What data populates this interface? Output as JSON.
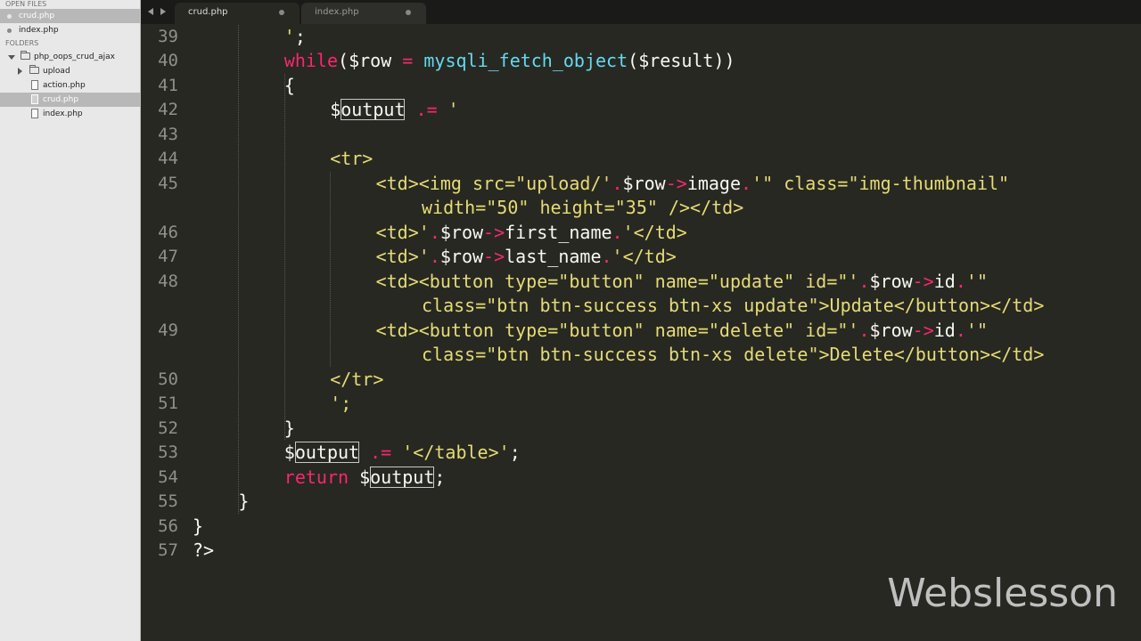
{
  "sidebar": {
    "open_files_header": "OPEN FILES",
    "open_files": [
      {
        "label": "crud.php",
        "active": true
      },
      {
        "label": "index.php",
        "active": false
      }
    ],
    "folders_header": "FOLDERS",
    "project_folder": "php_oops_crud_ajax",
    "folder_items": [
      {
        "label": "upload",
        "type": "folder",
        "active": false
      },
      {
        "label": "action.php",
        "type": "file",
        "active": false
      },
      {
        "label": "crud.php",
        "type": "file",
        "active": true
      },
      {
        "label": "index.php",
        "type": "file",
        "active": false
      }
    ]
  },
  "tabs": [
    {
      "label": "crud.php",
      "active": true
    },
    {
      "label": "index.php",
      "active": false
    }
  ],
  "editor": {
    "line_numbers": [
      "39",
      "40",
      "41",
      "42",
      "43",
      "44",
      "45",
      "",
      "46",
      "47",
      "48",
      "",
      "49",
      "",
      "50",
      "51",
      "52",
      "53",
      "54",
      "55",
      "56",
      "57"
    ],
    "lines": [
      [
        {
          "t": "'",
          "c": "str"
        },
        {
          "t": ";",
          "c": "plain"
        }
      ],
      [
        {
          "t": "while",
          "c": "kw"
        },
        {
          "t": "(",
          "c": "plain"
        },
        {
          "t": "$row",
          "c": "var"
        },
        {
          "t": " = ",
          "c": "op"
        },
        {
          "t": "mysqli_fetch_object",
          "c": "fn"
        },
        {
          "t": "(",
          "c": "plain"
        },
        {
          "t": "$result",
          "c": "var"
        },
        {
          "t": "))",
          "c": "plain"
        }
      ],
      [
        {
          "t": "{",
          "c": "plain"
        }
      ],
      [
        {
          "t": "$",
          "c": "var"
        },
        {
          "t": "output",
          "c": "var",
          "hl": true
        },
        {
          "t": " .= ",
          "c": "op"
        },
        {
          "t": "'",
          "c": "str"
        }
      ],
      [],
      [
        {
          "t": "<tr>",
          "c": "str"
        }
      ],
      [
        {
          "t": "<td><img src=\"upload/'",
          "c": "str"
        },
        {
          "t": ".",
          "c": "op"
        },
        {
          "t": "$row",
          "c": "var"
        },
        {
          "t": "->",
          "c": "op"
        },
        {
          "t": "image",
          "c": "var"
        },
        {
          "t": ".",
          "c": "op"
        },
        {
          "t": "'\" class=\"img-thumbnail\"",
          "c": "str"
        }
      ],
      [
        {
          "t": "width=\"50\" height=\"35\" /></td>",
          "c": "str"
        }
      ],
      [
        {
          "t": "<td>'",
          "c": "str"
        },
        {
          "t": ".",
          "c": "op"
        },
        {
          "t": "$row",
          "c": "var"
        },
        {
          "t": "->",
          "c": "op"
        },
        {
          "t": "first_name",
          "c": "var"
        },
        {
          "t": ".",
          "c": "op"
        },
        {
          "t": "'</td>",
          "c": "str"
        }
      ],
      [
        {
          "t": "<td>'",
          "c": "str"
        },
        {
          "t": ".",
          "c": "op"
        },
        {
          "t": "$row",
          "c": "var"
        },
        {
          "t": "->",
          "c": "op"
        },
        {
          "t": "last_name",
          "c": "var"
        },
        {
          "t": ".",
          "c": "op"
        },
        {
          "t": "'</td>",
          "c": "str"
        }
      ],
      [
        {
          "t": "<td><button type=\"button\" name=\"update\" id=\"'",
          "c": "str"
        },
        {
          "t": ".",
          "c": "op"
        },
        {
          "t": "$row",
          "c": "var"
        },
        {
          "t": "->",
          "c": "op"
        },
        {
          "t": "id",
          "c": "var"
        },
        {
          "t": ".",
          "c": "op"
        },
        {
          "t": "'\"",
          "c": "str"
        }
      ],
      [
        {
          "t": "class=\"btn btn-success btn-xs update\">Update</button></td>",
          "c": "str"
        }
      ],
      [
        {
          "t": "<td><button type=\"button\" name=\"delete\" id=\"'",
          "c": "str"
        },
        {
          "t": ".",
          "c": "op"
        },
        {
          "t": "$row",
          "c": "var"
        },
        {
          "t": "->",
          "c": "op"
        },
        {
          "t": "id",
          "c": "var"
        },
        {
          "t": ".",
          "c": "op"
        },
        {
          "t": "'\"",
          "c": "str"
        }
      ],
      [
        {
          "t": "class=\"btn btn-success btn-xs delete\">Delete</button></td>",
          "c": "str"
        }
      ],
      [
        {
          "t": "</tr>",
          "c": "str"
        }
      ],
      [
        {
          "t": "';",
          "c": "str"
        }
      ],
      [
        {
          "t": "}",
          "c": "plain"
        }
      ],
      [
        {
          "t": "$",
          "c": "var"
        },
        {
          "t": "output",
          "c": "var",
          "hl": true
        },
        {
          "t": " .= ",
          "c": "op"
        },
        {
          "t": "'</table>'",
          "c": "str"
        },
        {
          "t": ";",
          "c": "plain"
        }
      ],
      [
        {
          "t": "return",
          "c": "kw"
        },
        {
          "t": " $",
          "c": "var"
        },
        {
          "t": "output",
          "c": "var",
          "hl": true
        },
        {
          "t": ";",
          "c": "plain"
        }
      ],
      [
        {
          "t": "}",
          "c": "plain"
        }
      ],
      [
        {
          "t": "}",
          "c": "plain"
        }
      ],
      [
        {
          "t": "?>",
          "c": "plain"
        }
      ]
    ]
  },
  "watermark": "Webslesson"
}
